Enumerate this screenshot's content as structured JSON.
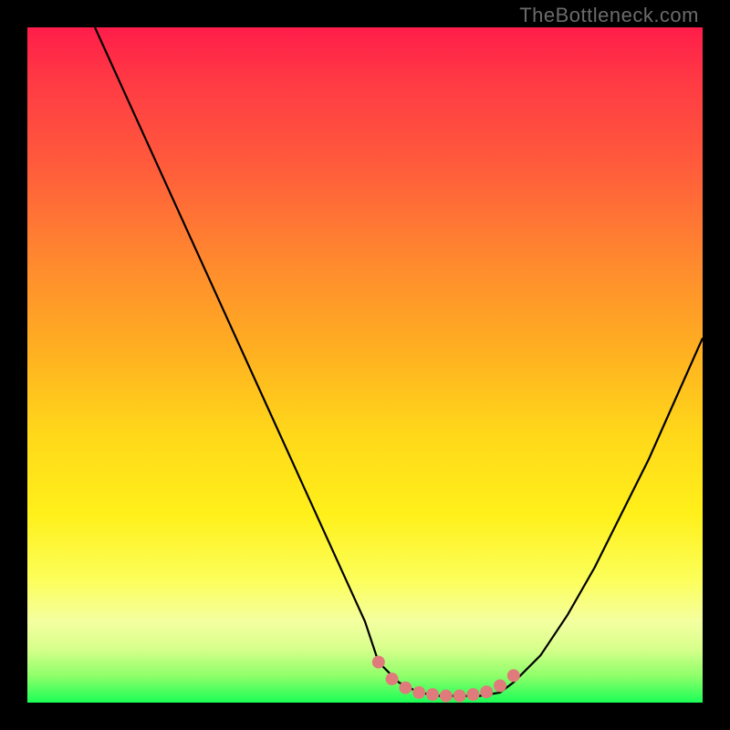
{
  "watermark": "TheBottleneck.com",
  "chart_data": {
    "type": "line",
    "title": "",
    "xlabel": "",
    "ylabel": "",
    "xlim": [
      0,
      100
    ],
    "ylim": [
      0,
      100
    ],
    "series": [
      {
        "name": "curve",
        "x": [
          10,
          15,
          20,
          25,
          30,
          35,
          40,
          45,
          50,
          52,
          55,
          58,
          61,
          64,
          67,
          70,
          72,
          76,
          80,
          84,
          88,
          92,
          96,
          100
        ],
        "y": [
          100,
          89,
          78,
          67,
          56,
          45,
          34,
          23,
          12,
          6,
          3,
          1.5,
          1,
          1,
          1,
          1.5,
          3,
          7,
          13,
          20,
          28,
          36,
          45,
          54
        ]
      },
      {
        "name": "highlight-dots",
        "x": [
          52,
          54,
          56,
          58,
          60,
          62,
          64,
          66,
          68,
          70,
          72
        ],
        "y": [
          6,
          3.5,
          2.2,
          1.5,
          1.2,
          1,
          1,
          1.2,
          1.6,
          2.5,
          4
        ]
      }
    ],
    "colors": {
      "curve": "#000000",
      "dots": "#e07b7b",
      "gradient_top": "#ff1d4a",
      "gradient_bottom": "#1aff57"
    }
  }
}
